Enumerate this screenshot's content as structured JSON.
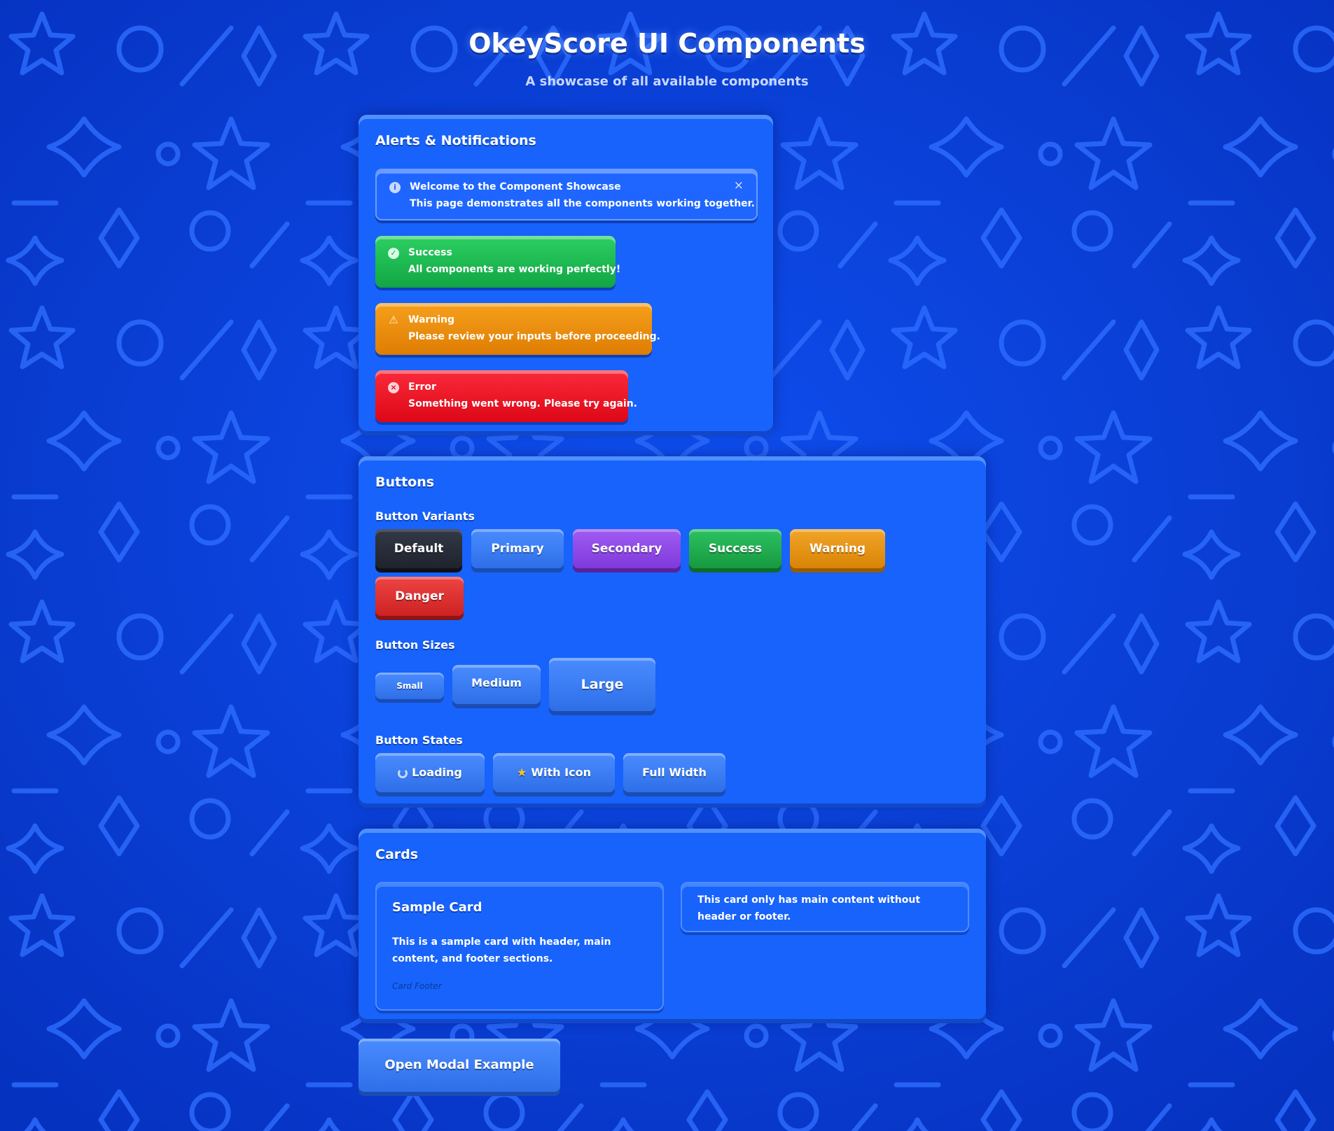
{
  "page": {
    "title": "OkeyScore UI Components",
    "subtitle": "A showcase of all available components"
  },
  "alerts_panel": {
    "title": "Alerts & Notifications",
    "alerts": [
      {
        "type": "info",
        "title": "Welcome to the Component Showcase",
        "message": "This page demonstrates all the components working together.",
        "close": "×"
      },
      {
        "type": "success",
        "title": "Success",
        "message": "All components are working perfectly!"
      },
      {
        "type": "warning",
        "title": "Warning",
        "message": "Please review your inputs before proceeding."
      },
      {
        "type": "error",
        "title": "Error",
        "message": "Something went wrong. Please try again."
      }
    ]
  },
  "buttons_panel": {
    "title": "Buttons",
    "variants_title": "Button Variants",
    "variants": [
      "Default",
      "Primary",
      "Secondary",
      "Success",
      "Warning",
      "Danger"
    ],
    "sizes_title": "Button Sizes",
    "sizes": [
      "Small",
      "Medium",
      "Large"
    ],
    "states_title": "Button States",
    "states": [
      "Loading",
      "With Icon",
      "Full Width"
    ]
  },
  "cards_panel": {
    "title": "Cards",
    "sample_card": {
      "header": "Sample Card",
      "body": "This is a sample card with header, main content, and footer sections.",
      "footer": "Card Footer"
    },
    "plain_card": {
      "body": "This card only has main content without header or footer."
    }
  },
  "modal_button": "Open Modal Example",
  "colors": {
    "background": "#0a3fd8",
    "panel": "#1763fb",
    "info": "#1e66ff",
    "success": "#17b24c",
    "warning": "#e88a06",
    "error": "#e30d1f",
    "btn_default": "#262b37",
    "btn_primary": "#3477f2",
    "btn_secondary": "#8d48e6",
    "btn_success": "#1fa84e",
    "btn_warning": "#e3920a",
    "btn_danger": "#dc2b2b"
  }
}
